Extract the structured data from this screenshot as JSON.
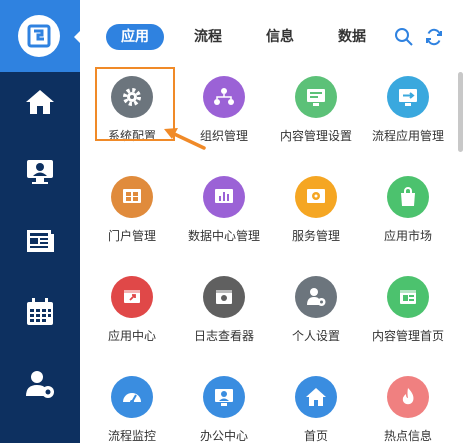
{
  "nav": {
    "tabs": [
      {
        "label": "应用",
        "active": true
      },
      {
        "label": "流程",
        "active": false
      },
      {
        "label": "信息",
        "active": false
      },
      {
        "label": "数据",
        "active": false
      }
    ]
  },
  "sidebar": {
    "items": [
      {
        "icon": "logo-icon"
      },
      {
        "icon": "home-icon"
      },
      {
        "icon": "user-monitor-icon"
      },
      {
        "icon": "news-icon"
      },
      {
        "icon": "calendar-icon"
      },
      {
        "icon": "user-settings-icon"
      }
    ]
  },
  "apps": [
    {
      "label": "系统配置",
      "color": "#6c757d",
      "icon": "gear-icon"
    },
    {
      "label": "组织管理",
      "color": "#9b62d6",
      "icon": "org-chart-icon"
    },
    {
      "label": "内容管理设置",
      "color": "#5cc178",
      "icon": "content-settings-icon"
    },
    {
      "label": "流程应用管理",
      "color": "#3aa8de",
      "icon": "workflow-icon"
    },
    {
      "label": "门户管理",
      "color": "#e08b3c",
      "icon": "portal-icon"
    },
    {
      "label": "数据中心管理",
      "color": "#9b62d6",
      "icon": "chart-icon"
    },
    {
      "label": "服务管理",
      "color": "#f5a623",
      "icon": "service-icon"
    },
    {
      "label": "应用市场",
      "color": "#4cc26e",
      "icon": "shopping-bag-icon"
    },
    {
      "label": "应用中心",
      "color": "#e04848",
      "icon": "app-center-icon"
    },
    {
      "label": "日志查看器",
      "color": "#606060",
      "icon": "log-viewer-icon"
    },
    {
      "label": "个人设置",
      "color": "#6c757d",
      "icon": "user-gear-icon"
    },
    {
      "label": "内容管理首页",
      "color": "#4cc26e",
      "icon": "content-home-icon"
    },
    {
      "label": "流程监控",
      "color": "#3a8de0",
      "icon": "gauge-icon"
    },
    {
      "label": "办公中心",
      "color": "#3a8de0",
      "icon": "office-icon"
    },
    {
      "label": "首页",
      "color": "#3a8de0",
      "icon": "home-icon"
    },
    {
      "label": "热点信息",
      "color": "#f08080",
      "icon": "flame-icon"
    }
  ]
}
